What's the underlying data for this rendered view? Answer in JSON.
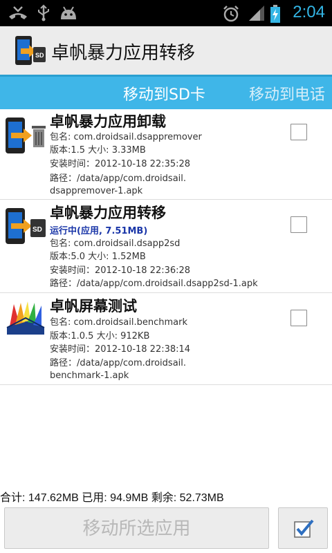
{
  "statusbar": {
    "time": "2:04"
  },
  "app": {
    "title": "卓帆暴力应用转移"
  },
  "tabs": [
    {
      "label": "移动到SD卡"
    },
    {
      "label": "移动到电话"
    }
  ],
  "apps": [
    {
      "name": "卓帆暴力应用卸载",
      "status": "",
      "package": "包名: com.droidsail.dsappremover",
      "version": "版本:1.5 大小: 3.33MB",
      "install_time": "安装时间：2012-10-18 22:35:28",
      "path_line1": "路径：/data/app/com.droidsail.",
      "path_line2": "dsappremover-1.apk",
      "checked": false
    },
    {
      "name": "卓帆暴力应用转移",
      "status": "运行中(应用, 7.51MB)",
      "package": "包名: com.droidsail.dsapp2sd",
      "version": "版本:5.0 大小: 1.52MB",
      "install_time": "安装时间：2012-10-18 22:36:28",
      "path_line1": "路径：/data/app/com.droidsail.dsapp2sd-1.apk",
      "path_line2": "",
      "checked": false
    },
    {
      "name": "卓帆屏幕测试",
      "status": "",
      "package": "包名: com.droidsail.benchmark",
      "version": "版本:1.0.5 大小: 912KB",
      "install_time": "安装时间：2012-10-18 22:38:14",
      "path_line1": "路径：/data/app/com.droidsail.",
      "path_line2": "benchmark-1.apk",
      "checked": false
    }
  ],
  "summary": "合计: 147.62MB 已用: 94.9MB 剩余: 52.73MB",
  "move_button": {
    "label": "移动所选应用"
  },
  "colors": {
    "accent": "#33b5e5",
    "tabbar": "#3fb6e8",
    "status_text": "#1a36a8"
  },
  "icons": {
    "statusbar_left": [
      "missed-call-icon",
      "usb-icon",
      "android-debug-icon"
    ],
    "statusbar_right": [
      "alarm-icon",
      "signal-icon",
      "battery-charging-icon"
    ],
    "select_all": "checkmark-icon"
  }
}
